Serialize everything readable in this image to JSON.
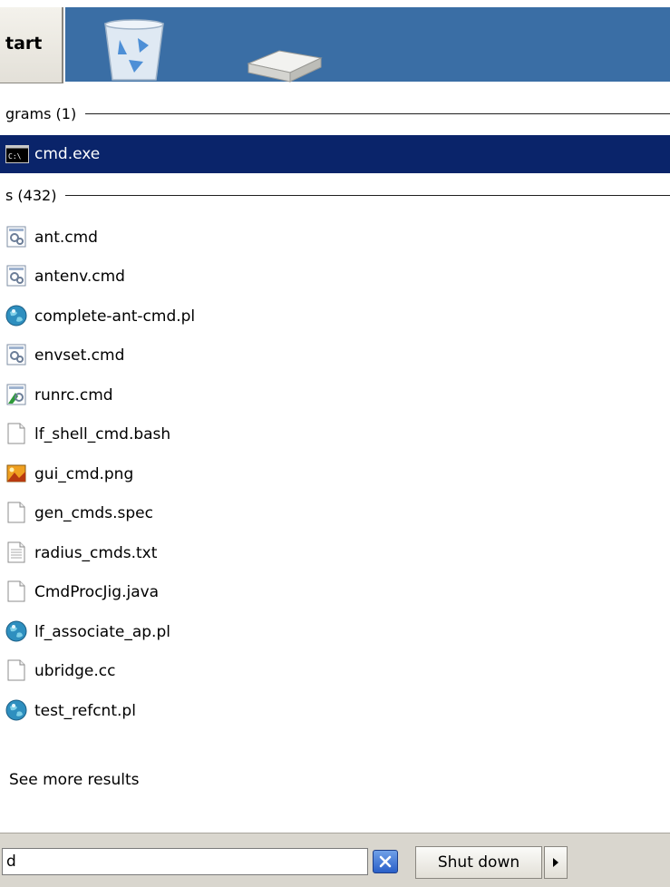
{
  "taskbar": {
    "start_label": "tart"
  },
  "sections": {
    "programs_header": "grams (1)",
    "files_header": "s (432)"
  },
  "programs": [
    {
      "label": "cmd.exe",
      "icon": "console-icon",
      "selected": true
    }
  ],
  "files": [
    {
      "label": "ant.cmd",
      "icon": "batch-file-icon"
    },
    {
      "label": "antenv.cmd",
      "icon": "batch-file-icon"
    },
    {
      "label": "complete-ant-cmd.pl",
      "icon": "perl-globe-icon"
    },
    {
      "label": "envset.cmd",
      "icon": "batch-file-icon"
    },
    {
      "label": "runrc.cmd",
      "icon": "batch-file-green-icon"
    },
    {
      "label": "lf_shell_cmd.bash",
      "icon": "blank-file-icon"
    },
    {
      "label": "gui_cmd.png",
      "icon": "image-file-icon"
    },
    {
      "label": "gen_cmds.spec",
      "icon": "blank-file-icon"
    },
    {
      "label": "radius_cmds.txt",
      "icon": "text-file-icon"
    },
    {
      "label": "CmdProcJig.java",
      "icon": "blank-file-icon"
    },
    {
      "label": "lf_associate_ap.pl",
      "icon": "perl-globe-icon"
    },
    {
      "label": "ubridge.cc",
      "icon": "blank-file-icon"
    },
    {
      "label": "test_refcnt.pl",
      "icon": "perl-globe-icon"
    }
  ],
  "see_more": "See more results",
  "search": {
    "value": "d"
  },
  "shutdown": {
    "label": "Shut down"
  },
  "colors": {
    "selection": "#0a246a",
    "desktop": "#3a6ea5",
    "panel": "#d9d6ce"
  }
}
